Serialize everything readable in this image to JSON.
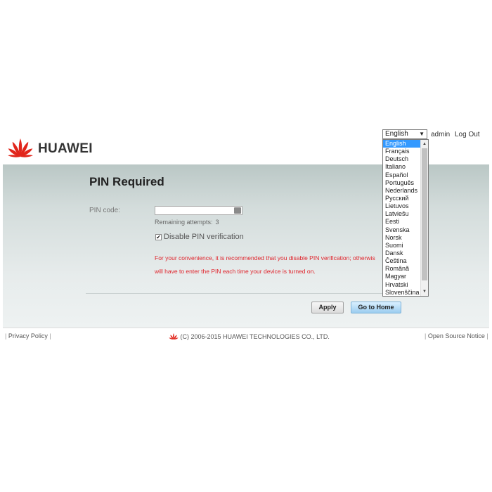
{
  "header": {
    "brand": "HUAWEI",
    "language_selected": "English",
    "user": "admin",
    "logout": "Log Out"
  },
  "language_options": [
    "English",
    "Français",
    "Deutsch",
    "Italiano",
    "Español",
    "Português",
    "Nederlands",
    "Русский",
    "Lietuvos",
    "Latviešu",
    "Eesti",
    "Svenska",
    "Norsk",
    "Suomi",
    "Dansk",
    "Čeština",
    "Română",
    "Magyar",
    "Hrvatski",
    "Slovenščina"
  ],
  "main": {
    "title": "PIN Required",
    "pin_label": "PIN code:",
    "pin_value": "",
    "attempts_label": "Remaining attempts:",
    "attempts_value": "3",
    "disable_pin_label": "Disable PIN verification",
    "disable_pin_checked": true,
    "warning_line1": "For your convenience, it is recommended that you disable PIN verification; otherwis",
    "warning_line2": "will have to enter the PIN each time your device is turned on.",
    "apply_label": "Apply",
    "home_label": "Go to Home"
  },
  "footer": {
    "privacy": "Privacy Policy",
    "copyright": "(C) 2006-2015 HUAWEI TECHNOLOGIES CO., LTD.",
    "open_source": "Open Source Notice"
  },
  "colors": {
    "brand_red": "#e1251b",
    "warning_red": "#e0242c",
    "selection_blue": "#3399ff"
  }
}
